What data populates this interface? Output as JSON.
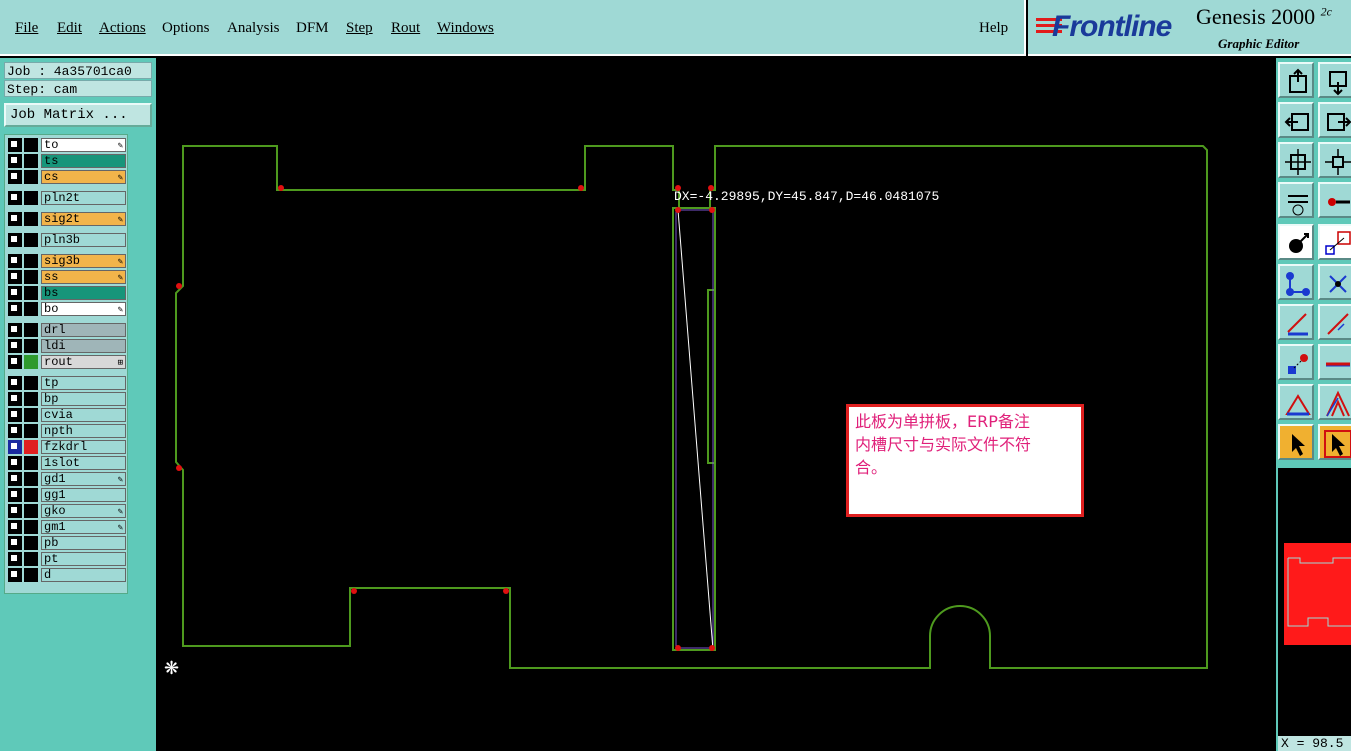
{
  "menu": {
    "items": [
      {
        "label": "File",
        "underline": true
      },
      {
        "label": "Edit",
        "underline": true
      },
      {
        "label": "Actions",
        "underline": true
      },
      {
        "label": "Options",
        "underline": false
      },
      {
        "label": "Analysis",
        "underline": false
      },
      {
        "label": "DFM",
        "underline": false
      },
      {
        "label": "Step",
        "underline": true
      },
      {
        "label": "Rout",
        "underline": true
      },
      {
        "label": "Windows",
        "underline": true
      }
    ],
    "help": "Help"
  },
  "logo": {
    "brand": "Frontline",
    "product": "Genesis 2000",
    "product_suffix": "2c",
    "subtitle": "Graphic Editor"
  },
  "info": {
    "job": "Job : 4a35701ca0",
    "step": "Step: cam",
    "matrix_button": "Job Matrix ..."
  },
  "layers": [
    {
      "name": "to",
      "color": "#ffffff",
      "icon": "✎",
      "group": 0
    },
    {
      "name": "ts",
      "color": "#17957a",
      "icon": "",
      "group": 0
    },
    {
      "name": "cs",
      "color": "#f2b44a",
      "icon": "✎",
      "group": 0
    },
    {
      "name": "pln2t",
      "color": "#9fd9d5",
      "icon": "",
      "group": 1
    },
    {
      "name": "sig2t",
      "color": "#f2b44a",
      "icon": "✎",
      "group": 2
    },
    {
      "name": "pln3b",
      "color": "#9fd9d5",
      "icon": "",
      "group": 3
    },
    {
      "name": "sig3b",
      "color": "#f2b44a",
      "icon": "✎",
      "group": 4
    },
    {
      "name": "ss",
      "color": "#f2b44a",
      "icon": "✎",
      "group": 4
    },
    {
      "name": "bs",
      "color": "#17957a",
      "icon": "",
      "group": 4
    },
    {
      "name": "bo",
      "color": "#ffffff",
      "icon": "✎",
      "group": 4
    },
    {
      "name": "drl",
      "color": "#9fb5b8",
      "icon": "",
      "group": 5
    },
    {
      "name": "ldi",
      "color": "#9fb5b8",
      "icon": "",
      "group": 5
    },
    {
      "name": "rout",
      "color": "#d8d8d8",
      "icon": "⊞",
      "group": 5,
      "swatch": "#2e9a2e"
    },
    {
      "name": "tp",
      "color": "#9fd9d5",
      "icon": "",
      "group": 6
    },
    {
      "name": "bp",
      "color": "#9fd9d5",
      "icon": "",
      "group": 6
    },
    {
      "name": "cvia",
      "color": "#9fd9d5",
      "icon": "",
      "group": 6
    },
    {
      "name": "npth",
      "color": "#9fd9d5",
      "icon": "",
      "group": 6
    },
    {
      "name": "fzkdrl",
      "color": "#9fd9d5",
      "icon": "",
      "group": 6,
      "swatch": "#e02020",
      "selected": true
    },
    {
      "name": "1slot",
      "color": "#9fd9d5",
      "icon": "",
      "group": 6
    },
    {
      "name": "gd1",
      "color": "#9fd9d5",
      "icon": "✎",
      "group": 6
    },
    {
      "name": "gg1",
      "color": "#9fd9d5",
      "icon": "",
      "group": 6
    },
    {
      "name": "gko",
      "color": "#9fd9d5",
      "icon": "✎",
      "group": 6
    },
    {
      "name": "gm1",
      "color": "#9fd9d5",
      "icon": "✎",
      "group": 6
    },
    {
      "name": "pb",
      "color": "#9fd9d5",
      "icon": "",
      "group": 6
    },
    {
      "name": "pt",
      "color": "#9fd9d5",
      "icon": "",
      "group": 6
    },
    {
      "name": "d",
      "color": "#9fd9d5",
      "icon": "",
      "group": 6
    }
  ],
  "canvas": {
    "measure": "DX=-4.29895,DY=45.847,D=46.0481075",
    "note_line1": "此板为单拼板，ERP备注",
    "note_line2": "内槽尺寸与实际文件不符",
    "note_line3": "合。",
    "outline_color": "#4e9a1e",
    "marker_color": "#e01010"
  },
  "status": {
    "coord": "X = 98.5"
  },
  "toolbar_icons": [
    "zoom-home-icon",
    "zoom-page-icon",
    "pan-left-icon",
    "pan-right-icon",
    "zoom-fit-icon",
    "zoom-center-icon",
    "snap-icon",
    "measure-icon",
    "select-feature-icon",
    "select-area-icon",
    "connect-nodes-icon",
    "delete-icon",
    "line-angle-icon",
    "line-draw-icon",
    "pad-add-icon",
    "horizontal-line-icon",
    "triangle-icon",
    "arrow-up-icon",
    "pointer-icon",
    "pointer-selected-icon"
  ]
}
